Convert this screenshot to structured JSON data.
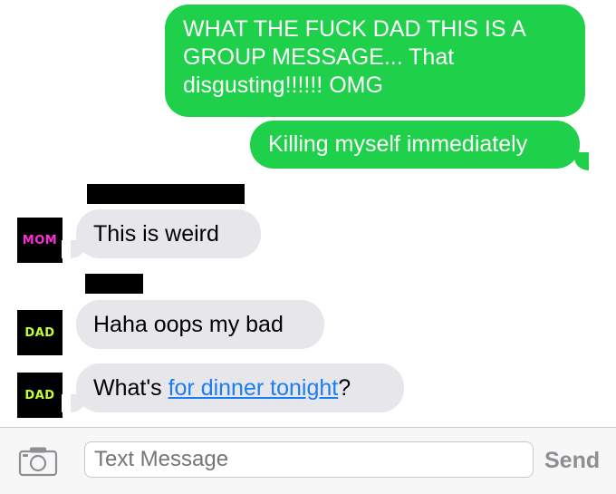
{
  "conversation": {
    "messages": [
      {
        "direction": "outgoing",
        "lines": [
          "WHAT THE FUCK DAD THIS IS A",
          "GROUP MESSAGE... That",
          "disgusting!!!!!! OMG"
        ]
      },
      {
        "direction": "outgoing",
        "text": "Killing myself immediately"
      },
      {
        "direction": "incoming",
        "sender_avatar": "MOM",
        "text": "This is weird"
      },
      {
        "direction": "incoming",
        "sender_avatar": "DAD",
        "text": "Haha oops my bad"
      },
      {
        "direction": "incoming",
        "sender_avatar": "DAD",
        "text_before": "What's ",
        "link_text": "for dinner tonight",
        "text_after": "?"
      }
    ]
  },
  "composer": {
    "placeholder": "Text Message",
    "send_label": "Send",
    "camera_icon": "camera-icon"
  },
  "colors": {
    "sent_bubble": "#1fd14a",
    "received_bubble": "#e6e6eb",
    "link": "#1a7df2",
    "mom_avatar_text": "#ff2bd6",
    "dad_avatar_text": "#c6ff2e"
  }
}
